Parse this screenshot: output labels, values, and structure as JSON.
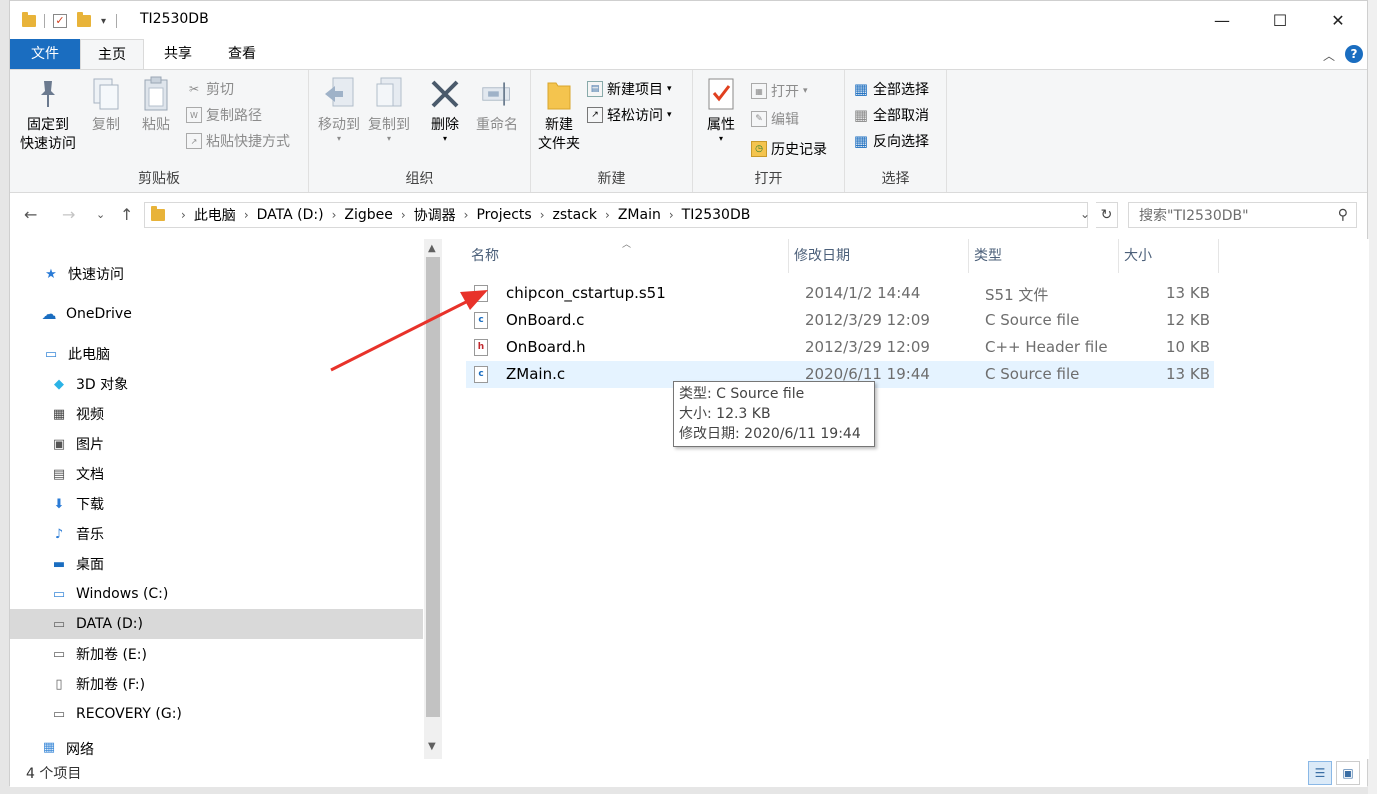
{
  "window": {
    "title": "TI2530DB",
    "controls": {
      "minimize": "—",
      "maximize": "☐",
      "close": "✕"
    }
  },
  "tabs": [
    {
      "label": "文件"
    },
    {
      "label": "主页"
    },
    {
      "label": "共享"
    },
    {
      "label": "查看"
    }
  ],
  "ribbon": {
    "clipboard": {
      "label": "剪贴板",
      "pin": "固定到\n快速访问",
      "copy": "复制",
      "paste": "粘贴",
      "cut": "剪切",
      "copy_path": "复制路径",
      "paste_shortcut": "粘贴快捷方式"
    },
    "organize": {
      "label": "组织",
      "move_to": "移动到",
      "copy_to": "复制到",
      "delete": "删除",
      "rename": "重命名"
    },
    "new": {
      "label": "新建",
      "new_folder": "新建\n文件夹",
      "new_item": "新建项目",
      "easy_access": "轻松访问"
    },
    "open": {
      "label": "打开",
      "properties": "属性",
      "open": "打开",
      "edit": "编辑",
      "history": "历史记录"
    },
    "select": {
      "label": "选择",
      "select_all": "全部选择",
      "select_none": "全部取消",
      "invert": "反向选择"
    }
  },
  "address": {
    "crumbs": [
      "此电脑",
      "DATA (D:)",
      "Zigbee",
      "协调器",
      "Projects",
      "zstack",
      "ZMain",
      "TI2530DB"
    ],
    "search_placeholder": "搜索\"TI2530DB\""
  },
  "nav": {
    "items": [
      {
        "label": "快速访问",
        "icon": "star-icon"
      },
      {
        "label": "OneDrive",
        "icon": "cloud-icon"
      },
      {
        "label": "此电脑",
        "icon": "computer-icon"
      },
      {
        "label": "3D 对象",
        "icon": "cube-icon"
      },
      {
        "label": "视频",
        "icon": "video-icon"
      },
      {
        "label": "图片",
        "icon": "picture-icon"
      },
      {
        "label": "文档",
        "icon": "document-icon"
      },
      {
        "label": "下载",
        "icon": "download-icon"
      },
      {
        "label": "音乐",
        "icon": "music-icon"
      },
      {
        "label": "桌面",
        "icon": "desktop-icon"
      },
      {
        "label": "Windows (C:)",
        "icon": "drive-icon"
      },
      {
        "label": "DATA (D:)",
        "icon": "drive-icon",
        "selected": true
      },
      {
        "label": "新加卷 (E:)",
        "icon": "drive-icon"
      },
      {
        "label": "新加卷 (F:)",
        "icon": "drive-icon"
      },
      {
        "label": "RECOVERY (G:)",
        "icon": "drive-icon"
      },
      {
        "label": "网络",
        "icon": "network-icon"
      }
    ]
  },
  "columns": {
    "name": "名称",
    "modified": "修改日期",
    "type": "类型",
    "size": "大小"
  },
  "files": [
    {
      "name": "chipcon_cstartup.s51",
      "modified": "2014/1/2 14:44",
      "type": "S51 文件",
      "size": "13 KB",
      "icon": "blank-file-icon"
    },
    {
      "name": "OnBoard.c",
      "modified": "2012/3/29 12:09",
      "type": "C Source file",
      "size": "12 KB",
      "icon": "c-file-icon"
    },
    {
      "name": "OnBoard.h",
      "modified": "2012/3/29 12:09",
      "type": "C++ Header file",
      "size": "10 KB",
      "icon": "h-file-icon"
    },
    {
      "name": "ZMain.c",
      "modified": "2020/6/11 19:44",
      "type": "C Source file",
      "size": "13 KB",
      "icon": "c-file-icon",
      "selected": true
    }
  ],
  "tooltip": {
    "line1": "类型: C Source file",
    "line2": "大小: 12.3 KB",
    "line3": "修改日期: 2020/6/11 19:44"
  },
  "status": {
    "count": "4 个项目"
  },
  "colors": {
    "accent": "#1a6dc0",
    "arrow": "#e8322a",
    "selected_row": "#e5f3ff",
    "selected_nav": "#d9d9d9"
  }
}
